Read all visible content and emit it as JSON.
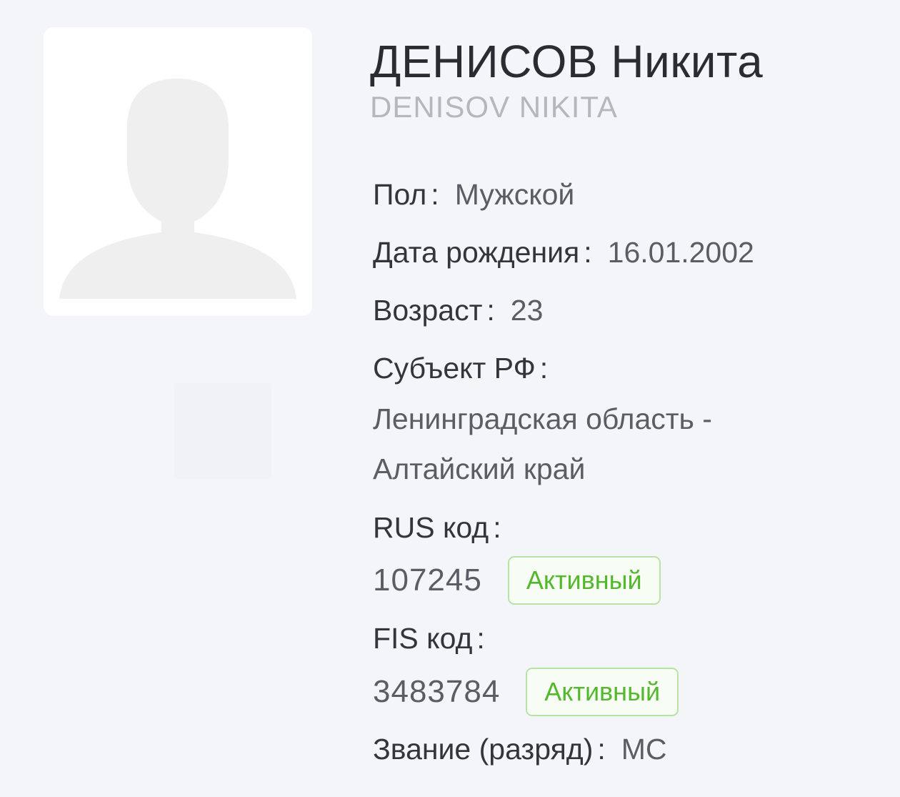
{
  "athlete": {
    "name_ru": "ДЕНИСОВ Никита",
    "name_en": "DENISOV NIKITA"
  },
  "fields": {
    "gender": {
      "label": "Пол",
      "value": "Мужской"
    },
    "birthdate": {
      "label": "Дата рождения",
      "value": "16.01.2002"
    },
    "age": {
      "label": "Возраст",
      "value": "23"
    },
    "region": {
      "label": "Субъект РФ",
      "value_line1": "Ленинградская область -",
      "value_line2": "Алтайский край"
    },
    "rus_code": {
      "label": "RUS код",
      "value": "107245",
      "status": "Активный"
    },
    "fis_code": {
      "label": "FIS код",
      "value": "3483784",
      "status": "Активный"
    },
    "rank": {
      "label": "Звание (разряд)",
      "value": "МС"
    }
  },
  "separator": ":",
  "icons": {
    "avatar": "user-silhouette-icon"
  },
  "colors": {
    "background": "#f4f5f9",
    "badge_text": "#54b82d",
    "badge_border": "#b7e3a4",
    "secondary_name": "#b4b7bd"
  }
}
